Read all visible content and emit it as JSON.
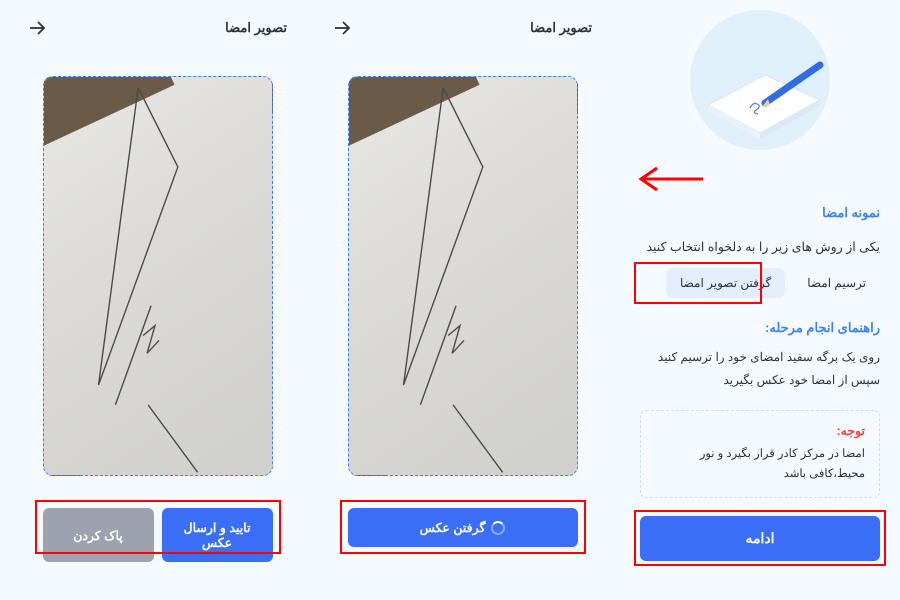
{
  "sidebar": {
    "sample_title": "نمونه امضا",
    "choose_text": "یکی از روش های زیر را به دلخواه انتخاب کنید",
    "tabs": {
      "draw": "ترسیم امضا",
      "capture": "گرفتن تصویر امضا"
    },
    "guide_title": "راهنمای انجام مرحله:",
    "guide_text": "روی یک برگه سفید امضای خود را ترسیم کنید سپس از امضا خود عکس بگیرید",
    "warning_title": "توجه:",
    "warning_text": "امضا در مرکز کادر قرار بگیرد و نور محیط،کافی باشد",
    "continue_label": "ادامه"
  },
  "panels": {
    "center": {
      "title": "تصویر امضا",
      "action": "گرفتن عکس"
    },
    "left": {
      "title": "تصویر امضا",
      "confirm": "تایید و ارسال عکس",
      "clear": "پاک کردن"
    }
  }
}
